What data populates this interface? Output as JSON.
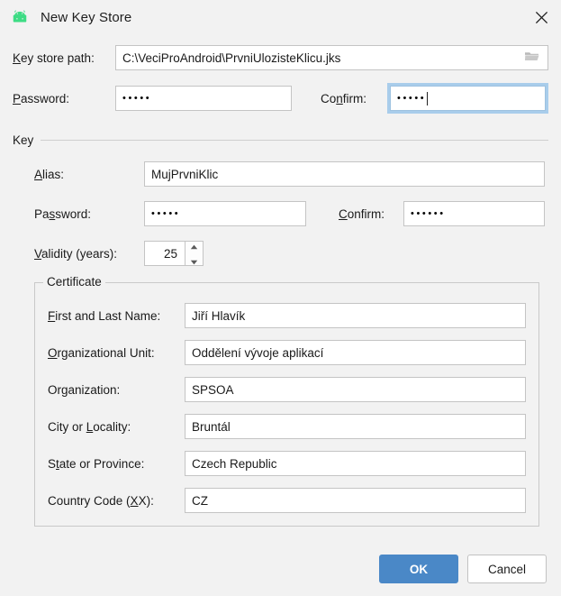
{
  "window": {
    "title": "New Key Store",
    "icon": "android-icon",
    "close_icon": "close-icon",
    "background": "#f2f2f2"
  },
  "keystore": {
    "path_label_pre": "",
    "path_label_mnemonic": "K",
    "path_label_post": "ey store path:",
    "path_value": "C:\\VeciProAndroid\\PrvniUlozisteKlicu.jks",
    "browse_icon": "folder-open-icon",
    "password_label_mnemonic": "P",
    "password_label_post": "assword:",
    "password_value": "•••••",
    "confirm_label_pre": "Co",
    "confirm_label_mnemonic": "n",
    "confirm_label_post": "firm:",
    "confirm_value": "•••••",
    "confirm_focused": true
  },
  "key_group": {
    "title": "Key",
    "alias_label_mnemonic": "A",
    "alias_label_post": "lias:",
    "alias_value": "MujPrvniKlic",
    "password_label_pre": "Pa",
    "password_label_mnemonic": "s",
    "password_label_post": "sword:",
    "password_value": "•••••",
    "confirm_label_mnemonic": "C",
    "confirm_label_post": "onfirm:",
    "confirm_value": "••••••",
    "validity_label_mnemonic": "V",
    "validity_label_post": "alidity (years):",
    "validity_value": "25",
    "spinner_up_icon": "chevron-up-icon",
    "spinner_down_icon": "chevron-down-icon"
  },
  "certificate": {
    "legend": "Certificate",
    "fields": [
      {
        "label_pre": "",
        "label_mnemonic": "F",
        "label_post": "irst and Last Name:",
        "value": "Jiří Hlavík"
      },
      {
        "label_pre": "",
        "label_mnemonic": "O",
        "label_post": "rganizational Unit:",
        "value": "Oddělení vývoje aplikací"
      },
      {
        "label_pre": "Or",
        "label_mnemonic": "g",
        "label_post": "anization:",
        "value": "SPSOA"
      },
      {
        "label_pre": "City or ",
        "label_mnemonic": "L",
        "label_post": "ocality:",
        "value": "Bruntál"
      },
      {
        "label_pre": "S",
        "label_mnemonic": "t",
        "label_post": "ate or Province:",
        "value": "Czech Republic"
      },
      {
        "label_pre": "Country Code (",
        "label_mnemonic": "X",
        "label_post": "X):",
        "value": "CZ"
      }
    ]
  },
  "footer": {
    "ok_label": "OK",
    "cancel_label": "Cancel",
    "ok_color": "#4a88c7"
  }
}
